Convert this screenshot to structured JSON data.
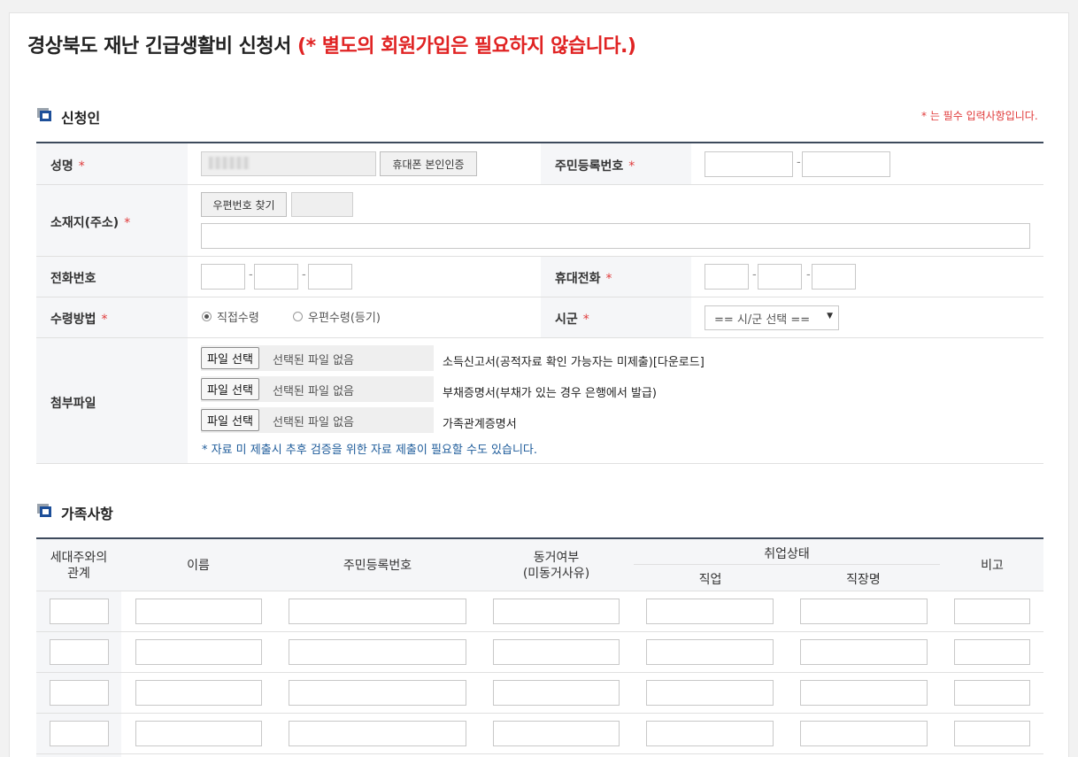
{
  "page": {
    "title": "경상북도 재난 긴급생활비 신청서",
    "notice": "(* 별도의 회원가입은 필요하지 않습니다.)"
  },
  "applicant": {
    "section_title": "신청인",
    "required_note": "* 는 필수 입력사항입니다.",
    "required_mark": "*",
    "name_label": "성명",
    "phone_verify_button": "휴대폰 본인인증",
    "rrn_label": "주민등록번호",
    "address_label": "소재지(주소)",
    "zip_button": "우편번호 찾기",
    "tel_label": "전화번호",
    "mobile_label": "휴대전화",
    "dash": "-",
    "receive_label": "수령방법",
    "receive_options": [
      "직접수령",
      "우편수령(등기)"
    ],
    "receive_selected": "직접수령",
    "city_label": "시군",
    "city_select": "== 시/군 선택 ==",
    "attach_label": "첨부파일",
    "file_button": "파일 선택",
    "file_none": "선택된 파일 없음",
    "attachments": [
      "소득신고서(공적자료 확인 가능자는 미제출)[다운로드]",
      "부채증명서(부채가 있는 경우 은행에서 발급)",
      "가족관계증명서"
    ],
    "attach_note": "* 자료 미 제출시 추후 검증을 위한 자료 제출이 필요할 수도 있습니다."
  },
  "family": {
    "section_title": "가족사항",
    "headers": {
      "relation": "세대주와의\n관계",
      "name": "이름",
      "rrn": "주민등록번호",
      "cohabit": "동거여부\n(미동거사유)",
      "employment": "취업상태",
      "job": "직업",
      "workplace": "직장명",
      "note": "비고"
    },
    "row_count": 4
  },
  "colors": {
    "required": "#e03b3b",
    "notice": "#e02323",
    "section_icon": "#1d4f99",
    "note_text": "#1d5b9a"
  }
}
